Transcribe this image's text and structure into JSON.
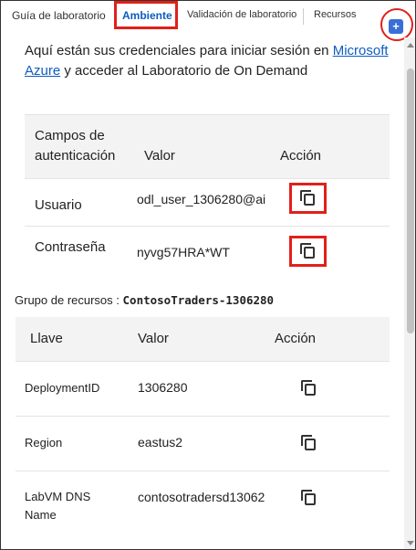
{
  "tabs": [
    {
      "label": "Guía de laboratorio"
    },
    {
      "label": "Ambiente"
    },
    {
      "label": "Validación de laboratorio"
    },
    {
      "label": "Recursos"
    }
  ],
  "intro": {
    "prefix": "Aquí están sus credenciales para iniciar sesión en ",
    "link1": "Microsoft",
    "link2": "Azure",
    "suffix": " y acceder al Laboratorio de On Demand"
  },
  "auth_table": {
    "headers": [
      "Campos de autenticación",
      "Valor",
      "Acción"
    ],
    "rows": [
      {
        "field": "Usuario",
        "value": "odl_user_1306280@ai"
      },
      {
        "field": "Contraseña",
        "value": "nyvg57HRA*WT"
      }
    ]
  },
  "resource_group": {
    "label": "Grupo de recursos :",
    "value": "ContosoTraders-1306280"
  },
  "resources_table": {
    "headers": [
      "Llave",
      "Valor",
      "Acción"
    ],
    "rows": [
      {
        "key": "DeploymentID",
        "value": "1306280"
      },
      {
        "key": "Region",
        "value": "eastus2"
      },
      {
        "key": "LabVM DNS Name",
        "value": "contosotradersd13062"
      }
    ]
  },
  "colors": {
    "accent": "#0f5cc0",
    "highlight": "#e0201a"
  },
  "icons": {
    "copy": "copy-icon",
    "add": "plus-icon"
  }
}
